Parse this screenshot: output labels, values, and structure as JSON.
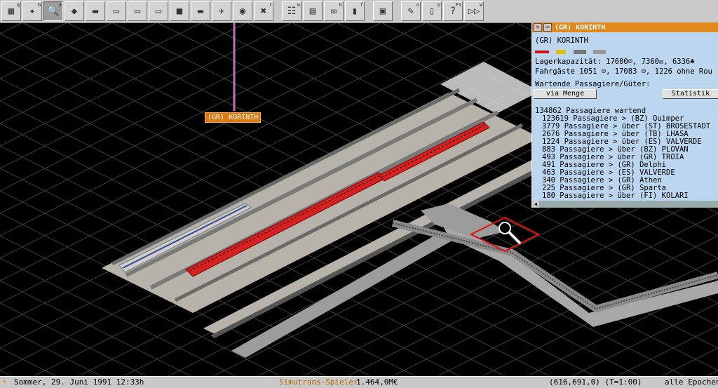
{
  "toolbar": {
    "tools": [
      {
        "name": "simutrans-menu-icon",
        "glyph": "▦",
        "hotkey": "q"
      },
      {
        "name": "map-view-icon",
        "glyph": "✦",
        "hotkey": "m"
      },
      {
        "name": "magnifier-tool-icon",
        "glyph": "🔍",
        "hotkey": "a",
        "active": true
      },
      {
        "name": "terrain-tools-icon",
        "glyph": "◆",
        "hotkey": ""
      },
      {
        "name": "road-tools-icon",
        "glyph": "▬",
        "hotkey": ""
      },
      {
        "name": "rail-tools-icon",
        "glyph": "▭",
        "hotkey": ""
      },
      {
        "name": "monorail-tools-icon",
        "glyph": "▭",
        "hotkey": ""
      },
      {
        "name": "tram-tools-icon",
        "glyph": "▭",
        "hotkey": ""
      },
      {
        "name": "truck-tools-icon",
        "glyph": "■",
        "hotkey": ""
      },
      {
        "name": "ship-tools-icon",
        "glyph": "▬",
        "hotkey": ""
      },
      {
        "name": "airport-tools-icon",
        "glyph": "✈",
        "hotkey": ""
      },
      {
        "name": "special-tools-icon",
        "glyph": "◉",
        "hotkey": ""
      },
      {
        "name": "remove-tool-icon",
        "glyph": "✖",
        "hotkey": "r"
      },
      {
        "name": "line-management-icon",
        "glyph": "☷",
        "hotkey": "w"
      },
      {
        "name": "list-icon",
        "glyph": "▤",
        "hotkey": ""
      },
      {
        "name": "mail-icon",
        "glyph": "✉",
        "hotkey": "b"
      },
      {
        "name": "finance-icon",
        "glyph": "▮",
        "hotkey": "f"
      },
      {
        "name": "depot-icon",
        "glyph": "▣",
        "hotkey": ""
      },
      {
        "name": "settings-icon",
        "glyph": "✎",
        "hotkey": "o"
      },
      {
        "name": "pause-icon",
        "glyph": "▯",
        "hotkey": "p"
      },
      {
        "name": "help-icon",
        "glyph": "?",
        "hotkey": "F1"
      },
      {
        "name": "fast-forward-icon",
        "glyph": "▷▷",
        "hotkey": "w"
      }
    ]
  },
  "map": {
    "station_label": "(GR) KORINTH"
  },
  "station_window": {
    "title": "(GR) KORINTH",
    "name": "(GR) KORINTH",
    "capacity": "Lagerkapazität: 17600☺,  7360✉,  6336♣",
    "passengers": "Fahrgäste 1051 ☺, 17083 ☺, 1226 ohne Rou",
    "waiting_heading": "Wartende Passagiere/Güter:",
    "via_button": "via Menge",
    "stats_button": "Statistik",
    "waiting_total": "134862 Passagiere wartend",
    "entries": [
      "123619 Passagiere > (BZ) Quimper",
      "3779 Passagiere >  über (ST) BROSESTADT",
      "2676 Passagiere >  über (TB) LHASA",
      "1224 Passagiere >  über (ES) VALVERDE",
      "883 Passagiere >  über (BZ) PLOVAN",
      "493 Passagiere >  über (GR) TROIA",
      "491 Passagiere > (GR) Delphi",
      "463 Passagiere > (ES) VALVERDE",
      "340 Passagiere > (GR) Athen",
      "225 Passagiere > (GR) Sparta",
      "180 Passagiere >  über (FI) KOLARI"
    ]
  },
  "status": {
    "date": "Sommer, 29. Juni 1991 12:33h",
    "player": "Simutrans-Spieler",
    "money": "1.464,0M€",
    "coords": "(616,691,0) (T=1:00)",
    "epochs": "alle Epochen"
  },
  "colors": {
    "title_bar": "#e08a1e",
    "window_bg": "#bcd6f0",
    "train_red": "#d82020",
    "train_silver": "#c8c8c8",
    "station_label": "#e07a10"
  }
}
